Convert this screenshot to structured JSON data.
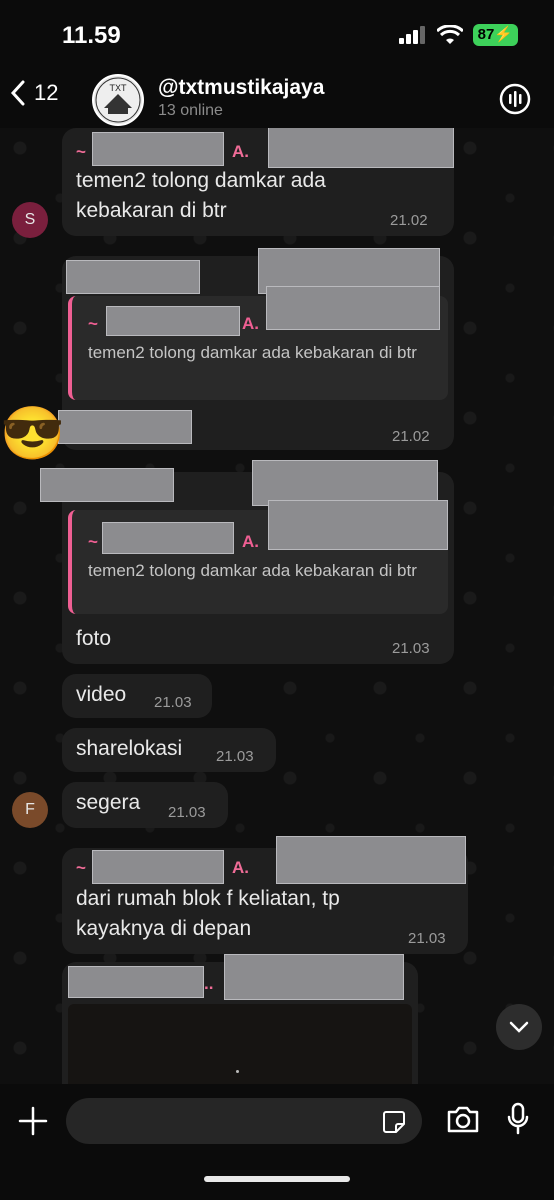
{
  "status": {
    "time": "11.59",
    "battery": "87"
  },
  "header": {
    "back_count": "12",
    "group_name": "@txtmustikajaya",
    "subtitle": "13 online",
    "logo_text": "TXT"
  },
  "messages": {
    "m1": {
      "avatar_letter": "S",
      "sender_suffix": "~",
      "sender_suffix2": "A.",
      "text": "temen2 tolong damkar ada kebakaran di btr",
      "time": "21.02"
    },
    "m2": {
      "quote_prefix": "~",
      "quote_suffix": "A.",
      "quote_text": "temen2 tolong damkar ada kebakaran di btr",
      "time": "21.02",
      "emoji": "😎"
    },
    "m3": {
      "quote_prefix": "~",
      "quote_suffix": "A.",
      "quote_text": "temen2 tolong damkar ada kebakaran di btr",
      "text": "foto",
      "time": "21.03"
    },
    "m4": {
      "text": "video",
      "time": "21.03"
    },
    "m5": {
      "text": "sharelokasi",
      "time": "21.03"
    },
    "m6": {
      "avatar_letter": "F",
      "text": "segera",
      "time": "21.03"
    },
    "m7": {
      "sender_prefix": "~",
      "sender_suffix": "A.",
      "text": "dari rumah blok f keliatan, tp kayaknya di depan",
      "time": "21.03"
    },
    "m8": {
      "sender_suffix": ".."
    }
  },
  "colors": {
    "sender": "#ef6c97",
    "bubble": "#1f1f1f",
    "avatar_s": "#7a1f3d",
    "avatar_f": "#7a4a2a"
  }
}
